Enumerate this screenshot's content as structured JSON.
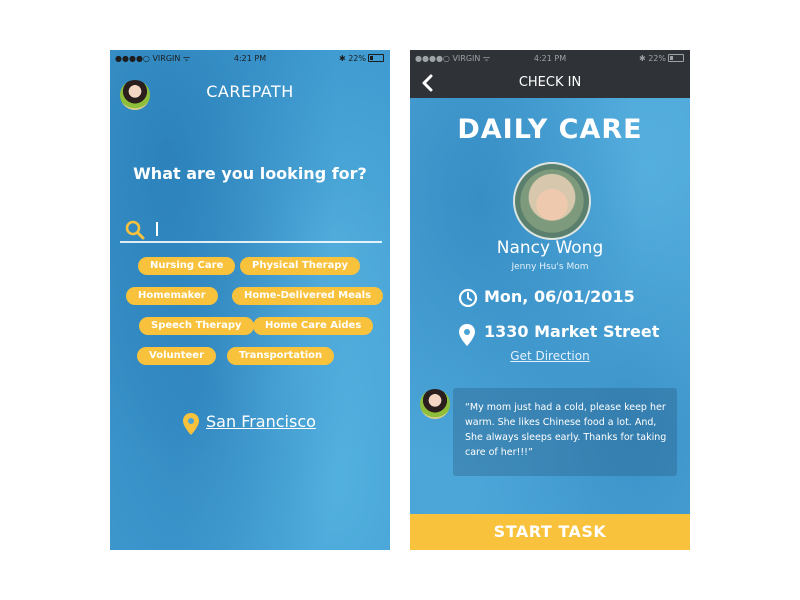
{
  "screen1": {
    "status": {
      "carrier": "●●●●○ VIRGIN ᯤ",
      "time": "4:21 PM",
      "battery": "✱ 22%"
    },
    "app_title": "CAREPATH",
    "question": "What are you looking for?",
    "search": {
      "value": ""
    },
    "chips": [
      "Nursing Care",
      "Physical Therapy",
      "Homemaker",
      "Home-Delivered Meals",
      "Speech Therapy",
      "Home Care Aides",
      "Volunteer",
      "Transportation"
    ],
    "location": "San Francisco"
  },
  "screen2": {
    "status": {
      "carrier": "●●●●○ VIRGIN ᯤ",
      "time": "4:21 PM",
      "battery": "✱ 22%"
    },
    "nav_title": "CHECK IN",
    "heading": "DAILY CARE",
    "patient_name": "Nancy Wong",
    "relation": "Jenny Hsu's Mom",
    "date": "Mon, 06/01/2015",
    "address": "1330 Market Street",
    "get_direction": "Get Direction",
    "note": "“My mom just had a cold, please keep her warm. She likes Chinese food a lot. And, She always sleeps early. Thanks for taking care of her!!!”",
    "start_button": "START TASK"
  },
  "colors": {
    "accent": "#f9c23c",
    "background": "#4aa3d5",
    "navbar": "#2f3338"
  }
}
